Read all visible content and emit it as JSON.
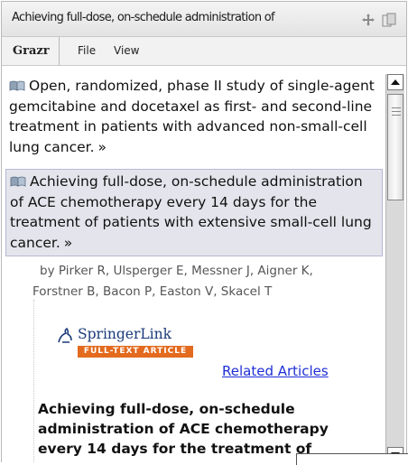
{
  "window": {
    "title": "Achieving full-dose, on-schedule administration of",
    "icons": [
      "move-icon",
      "window-icon"
    ]
  },
  "menu": {
    "brand": "Grazr",
    "file": "File",
    "view": "View"
  },
  "items": [
    {
      "icon": "feed-item-icon",
      "text": "Open, randomized, phase II study of single-agent gemcitabine and docetaxel as first- and second-line treatment in patients with advanced non-small-cell lung cancer.",
      "more": "»"
    },
    {
      "icon": "feed-item-icon",
      "text": "Achieving full-dose, on-schedule administration of ACE chemotherapy every 14 days for the treatment of patients with extensive small-cell lung cancer.",
      "more": "»"
    }
  ],
  "detail": {
    "authors_line1": "by Pirker R, Ulsperger E, Messner J, Aigner K,",
    "authors_line2": "Forstner B, Bacon P, Easton V, Skacel T",
    "springer_name": "SpringerLink",
    "springer_badge": "FULL-TEXT ARTICLE",
    "related_link": "Related Articles",
    "article_title": "Achieving full-dose, on-schedule administration of ACE chemotherapy every 14 days for the treatment of"
  },
  "colors": {
    "link": "#1f2fd6",
    "selected_bg": "#e4e4ec",
    "springer_orange": "#e36a1e",
    "springer_blue": "#1a3a7a"
  }
}
